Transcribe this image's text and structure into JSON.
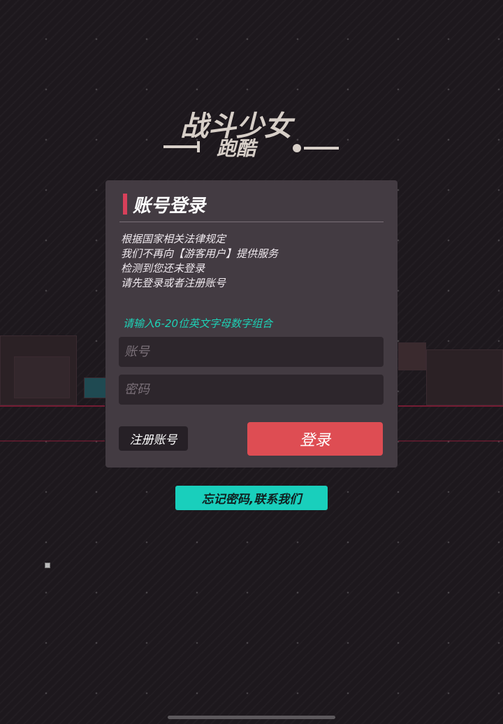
{
  "logo": {
    "line1": "战斗少女",
    "line2": "跑酷"
  },
  "login_panel": {
    "title": "账号登录",
    "notice_lines": [
      "根据国家相关法律规定",
      "我们不再向【游客用户】提供服务",
      "检测到您还未登录",
      "请先登录或者注册账号"
    ],
    "hint": "请输入6-20位英文字母数字组合",
    "account_placeholder": "账号",
    "password_placeholder": "密码",
    "register_label": "注册账号",
    "login_label": "登录"
  },
  "forgot_label": "忘记密码,联系我们",
  "colors": {
    "accent_red": "#de4d53",
    "accent_teal": "#19cfbc",
    "panel_bg": "#433b42",
    "title_bar": "#d8405a"
  }
}
